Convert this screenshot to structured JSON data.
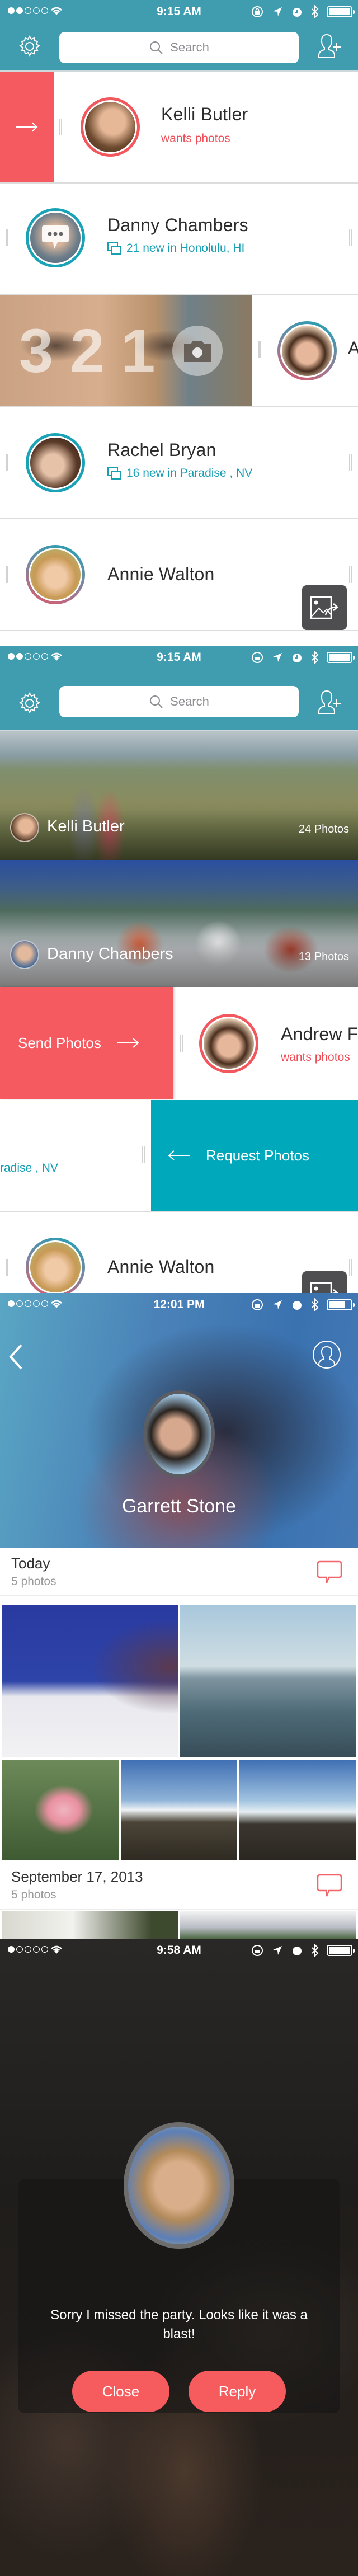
{
  "colors": {
    "teal_header": "#3f9daf",
    "accent_red": "#f55a60",
    "accent_teal": "#00a8bc",
    "link_teal": "#17a0b4",
    "share_button": "#4e4e50"
  },
  "screens": [
    {
      "status": {
        "time": "9:15 AM",
        "signal_bars": 2,
        "battery_percent": 100
      },
      "search": {
        "placeholder": "Search"
      },
      "rows": [
        {
          "name": "Kelli Butler",
          "subtitle": "wants photos",
          "subtitle_style": "request",
          "swipe_action_icon": "arrow-right-icon"
        },
        {
          "name": "Danny Chambers",
          "subtitle": "21 new in Honolulu, HI",
          "subtitle_style": "new-photos",
          "overlay_icon": "chat-bubble-icon"
        },
        {
          "name": "A",
          "countdown": [
            "3",
            "2",
            "1"
          ],
          "countdown_icon": "camera-icon"
        },
        {
          "name": "Rachel Bryan",
          "subtitle": "16 new in Paradise , NV",
          "subtitle_style": "new-photos"
        },
        {
          "name": "Annie Walton",
          "subtitle": ""
        }
      ]
    },
    {
      "status": {
        "time": "9:15 AM",
        "signal_bars": 2,
        "battery_percent": 100
      },
      "search": {
        "placeholder": "Search"
      },
      "cards": [
        {
          "name": "Kelli Butler",
          "count": "24 Photos"
        },
        {
          "name": "Danny Chambers",
          "count": "13 Photos"
        }
      ],
      "send_row": {
        "action_label": "Send Photos",
        "name": "Andrew F",
        "subtitle": "wants photos"
      },
      "request_row": {
        "action_label": "Request Photos",
        "subtitle_fragment": "radise , NV"
      },
      "annie_row": {
        "name": "Annie Walton"
      }
    },
    {
      "status": {
        "time": "12:01 PM",
        "signal_bars": 1,
        "battery_percent": 75
      },
      "profile": {
        "name": "Garrett Stone"
      },
      "sections": [
        {
          "title": "Today",
          "count": "5 photos"
        },
        {
          "title": "September 17, 2013",
          "count": "5 photos"
        }
      ]
    },
    {
      "status": {
        "time": "9:58 AM",
        "signal_bars": 1,
        "battery_percent": 100
      },
      "dialog": {
        "message": "Sorry I missed the party. Looks like it was a blast!",
        "close_label": "Close",
        "reply_label": "Reply"
      }
    }
  ]
}
